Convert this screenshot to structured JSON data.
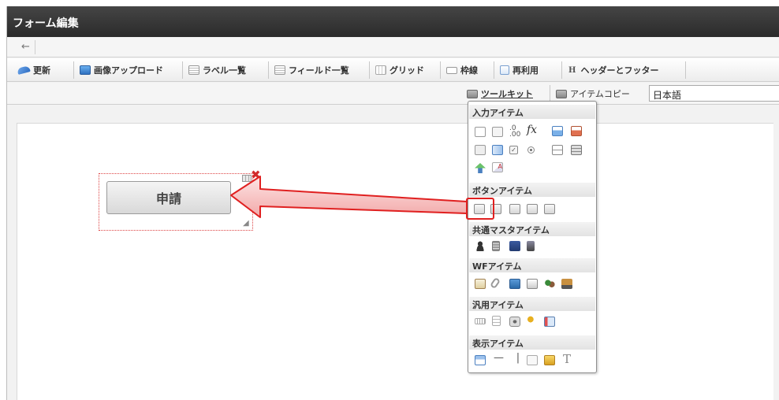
{
  "window": {
    "title": "フォーム編集"
  },
  "nav": {
    "back_glyph": "←"
  },
  "toolbar": {
    "items": [
      {
        "label": "更新",
        "icon": "refresh-icon",
        "color": "#3b7bd4"
      },
      {
        "label": "画像アップロード",
        "icon": "image-upload-icon",
        "color": "#4a90d9"
      },
      {
        "label": "ラベル一覧",
        "icon": "label-list-icon",
        "color": "#9a9a9a"
      },
      {
        "label": "フィールド一覧",
        "icon": "field-list-icon",
        "color": "#9a9a9a"
      },
      {
        "label": "グリッド",
        "icon": "grid-icon",
        "color": "#aaaaaa"
      },
      {
        "label": "枠線",
        "icon": "border-icon",
        "color": "#aaaaaa"
      },
      {
        "label": "再利用",
        "icon": "reuse-icon",
        "color": "#6a9bd8"
      },
      {
        "label": "ヘッダーとフッター",
        "icon_text": "H",
        "icon": "header-footer-icon"
      }
    ]
  },
  "toolbar2": {
    "toolkit_label": "ツールキット",
    "item_copy_label": "アイテムコピー",
    "language_value": "日本語"
  },
  "canvas": {
    "button_label": "申請"
  },
  "palette": {
    "categories": [
      {
        "label": "入力アイテム"
      },
      {
        "label": "ボタンアイテム"
      },
      {
        "label": "共通マスタアイテム"
      },
      {
        "label": "WFアイテム"
      },
      {
        "label": "汎用アイテム"
      },
      {
        "label": "表示アイテム"
      }
    ],
    "input_icons": [
      "textbox-icon",
      "textbox-label-icon",
      "number-icon",
      "formula-icon",
      "date-icon",
      "datetime-icon",
      "select-icon",
      "list-icon",
      "checkbox-icon",
      "radio-icon",
      "toggle-icon",
      "table-icon",
      "upload-icon",
      "text-style-icon"
    ],
    "button_icons": [
      "button-apply-icon",
      "button-next-icon",
      "button-back-icon",
      "button-return-icon",
      "button-forward-icon"
    ],
    "master_icons": [
      "user-icon",
      "organization-icon",
      "group-icon",
      "role-icon"
    ],
    "wf_icons": [
      "clipboard-icon",
      "attachment-icon",
      "image-icon",
      "document-icon",
      "people-icon",
      "stamp-icon"
    ],
    "general_icons": [
      "ruler-icon",
      "note-icon",
      "camera-icon",
      "key-icon",
      "card-icon"
    ],
    "display_icons": [
      "label-display-icon",
      "hline-icon",
      "vline-icon",
      "frame-icon",
      "picture-icon",
      "text-icon"
    ],
    "formula_glyph": "fx",
    "text_glyph": "T",
    "hline_glyph": "—",
    "vline_glyph": "|"
  },
  "colors": {
    "accent_red": "#e02020",
    "arrow_fill": "#f7c7c7",
    "title_bg": "#333333"
  }
}
